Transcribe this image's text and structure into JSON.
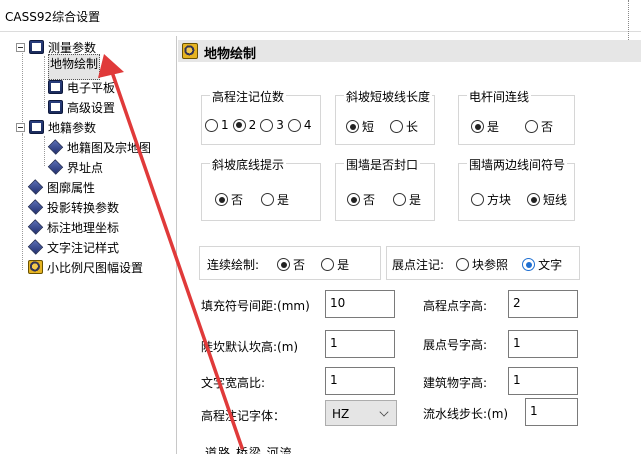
{
  "window": {
    "title": "CASS92综合设置"
  },
  "tree": {
    "items": [
      {
        "label": "测量参数"
      },
      {
        "label": "地物绘制"
      },
      {
        "label": "电子平板"
      },
      {
        "label": "高级设置"
      },
      {
        "label": "地籍参数"
      },
      {
        "label": "地籍图及宗地图"
      },
      {
        "label": "界址点"
      },
      {
        "label": "图廓属性"
      },
      {
        "label": "投影转换参数"
      },
      {
        "label": "标注地理坐标"
      },
      {
        "label": "文字注记样式"
      },
      {
        "label": "小比例尺图幅设置"
      }
    ],
    "selected": "地物绘制"
  },
  "panel": {
    "title": "地物绘制",
    "groups": {
      "elevation_pos": {
        "caption": "高程注记位数",
        "options": [
          "1",
          "2",
          "3",
          "4"
        ],
        "selected": "2"
      },
      "slope_length": {
        "caption": "斜坡短坡线长度",
        "options": [
          "短",
          "长"
        ],
        "selected": "短"
      },
      "pole_connect": {
        "caption": "电杆间连线",
        "options": [
          "是",
          "否"
        ],
        "selected": "是"
      },
      "slope_bottom": {
        "caption": "斜坡底线提示",
        "options": [
          "否",
          "是"
        ],
        "selected": "否"
      },
      "wall_closed": {
        "caption": "围墙是否封口",
        "options": [
          "否",
          "是"
        ],
        "selected": "否"
      },
      "wall_symbol": {
        "caption": "围墙两边线间符号",
        "options": [
          "方块",
          "短线"
        ],
        "selected": "短线"
      },
      "continuous": {
        "caption": "连续绘制:",
        "options": [
          "否",
          "是"
        ],
        "selected": "否"
      },
      "point_note": {
        "caption": "展点注记:",
        "options": [
          "块参照",
          "文字"
        ],
        "selected": "文字"
      }
    },
    "fields": {
      "fill_spacing": {
        "label": "填充符号间距:(mm)",
        "value": "10"
      },
      "elev_text_height": {
        "label": "高程点字高:",
        "value": "2"
      },
      "ridge_default_height": {
        "label": "陡坎默认坎高:(m)",
        "value": "1"
      },
      "point_no_height": {
        "label": "展点号字高:",
        "value": "1"
      },
      "text_ratio": {
        "label": "文字宽高比:",
        "value": "1"
      },
      "building_text_height": {
        "label": "建筑物字高:",
        "value": "1"
      },
      "elev_font": {
        "label": "高程注记字体：",
        "value": "HZ"
      },
      "flow_step": {
        "label": "流水线步长:(m)",
        "value": "1"
      }
    },
    "cut_text": "道路    桥梁    河流"
  },
  "colors": {
    "arrow": "#e03a3a",
    "accent_radio": "#1f6fd1"
  }
}
